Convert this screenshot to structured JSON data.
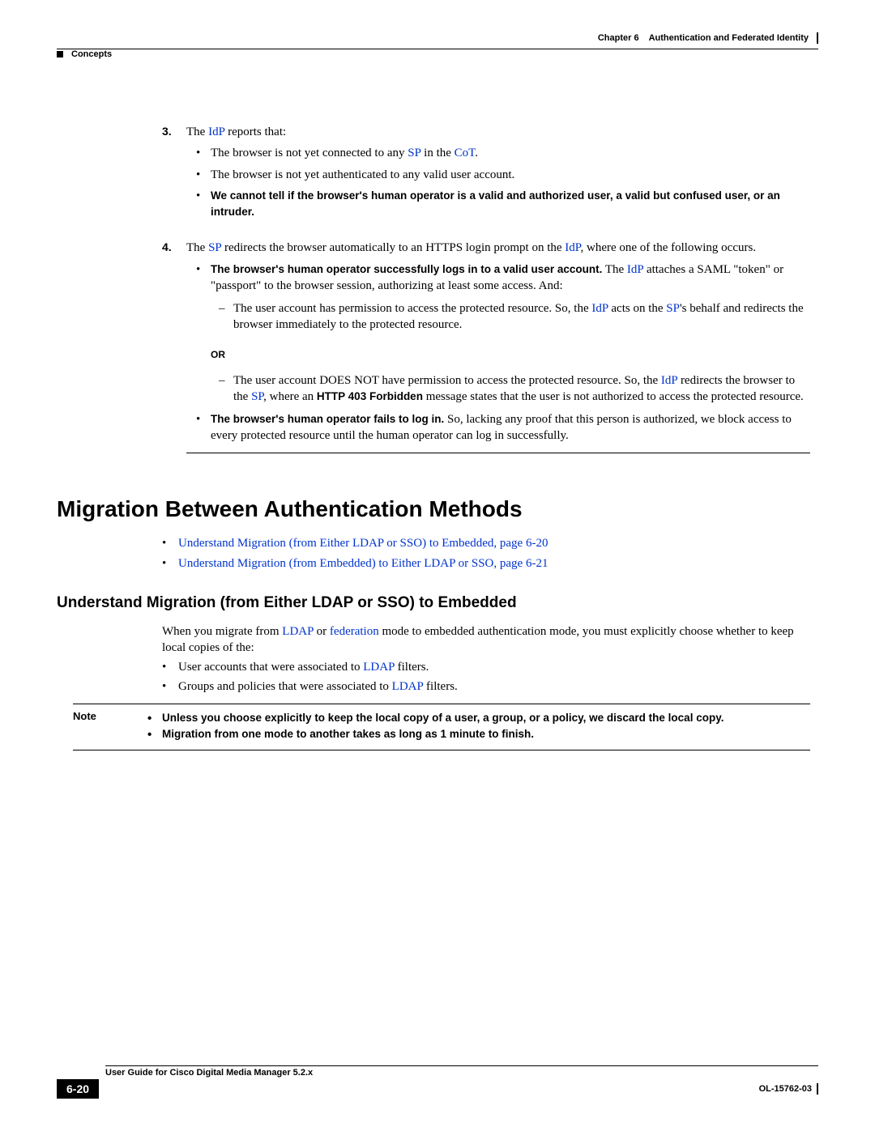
{
  "header": {
    "chapter_label": "Chapter 6",
    "chapter_title": "Authentication and Federated Identity",
    "section_running": "Concepts"
  },
  "list3": {
    "num": "3.",
    "lead_pre": "The ",
    "lead_link": "IdP",
    "lead_post": " reports that:",
    "b1_pre": "The browser is not yet connected to any ",
    "b1_sp": "SP",
    "b1_mid": " in the ",
    "b1_cot": "CoT",
    "b1_end": ".",
    "b2": "The browser is not yet authenticated to any valid user account.",
    "b3": "We cannot tell if the browser's human operator is a valid and authorized user, a valid but confused user, or an intruder."
  },
  "list4": {
    "num": "4.",
    "lead_pre": "The ",
    "lead_sp": "SP",
    "lead_mid": " redirects the browser automatically to an HTTPS login prompt on the ",
    "lead_idp": "IdP",
    "lead_post": ", where one of the following occurs.",
    "success_bold": "The browser's human operator successfully logs in to a valid user account.",
    "success_post_pre": " The ",
    "success_idp": "IdP",
    "success_post": " attaches a SAML \"token\" or \"passport\" to the browser session, authorizing at least some access. And:",
    "d1_pre": "The user account has permission to access the protected resource. So, the ",
    "d1_idp": "IdP",
    "d1_mid": " acts on the ",
    "d1_sp": "SP",
    "d1_post": "'s behalf and redirects the browser immediately to the protected resource.",
    "or": "OR",
    "d2_pre": "The user account DOES NOT have permission to access the protected resource. So, the ",
    "d2_idp": "IdP",
    "d2_mid": " redirects the browser to the ",
    "d2_sp": "SP",
    "d2_mid2": ", where an ",
    "d2_http": "HTTP 403 Forbidden",
    "d2_post": " message states that the user is not authorized to access the protected resource.",
    "fail_bold": "The browser's human operator fails to log in.",
    "fail_post": " So, lacking any proof that this person is authorized, we block access to every protected resource until the human operator can log in successfully."
  },
  "h1": "Migration Between Authentication Methods",
  "mig_links": {
    "l1": "Understand Migration (from Either LDAP or SSO) to Embedded, page 6-20",
    "l2": "Understand Migration (from Embedded) to Either LDAP or SSO, page 6-21"
  },
  "h2": "Understand Migration (from Either LDAP or SSO) to Embedded",
  "para": {
    "pre": "When you migrate from ",
    "ldap": "LDAP",
    "mid1": " or ",
    "fed": "federation",
    "post": " mode to embedded authentication mode, you must explicitly choose whether to keep local copies of the:"
  },
  "keep": {
    "b1_pre": "User accounts that were associated to ",
    "b1_ldap": "LDAP",
    "b1_post": " filters.",
    "b2_pre": "Groups and policies that were associated to ",
    "b2_ldap": "LDAP",
    "b2_post": " filters."
  },
  "note": {
    "label": "Note",
    "n1": "Unless you choose explicitly to keep the local copy of a user, a group, or a policy, we discard the local copy.",
    "n2": "Migration from one mode to another takes as long as 1 minute to finish."
  },
  "footer": {
    "guide": "User Guide for Cisco Digital Media Manager 5.2.x",
    "page": "6-20",
    "doc": "OL-15762-03"
  }
}
